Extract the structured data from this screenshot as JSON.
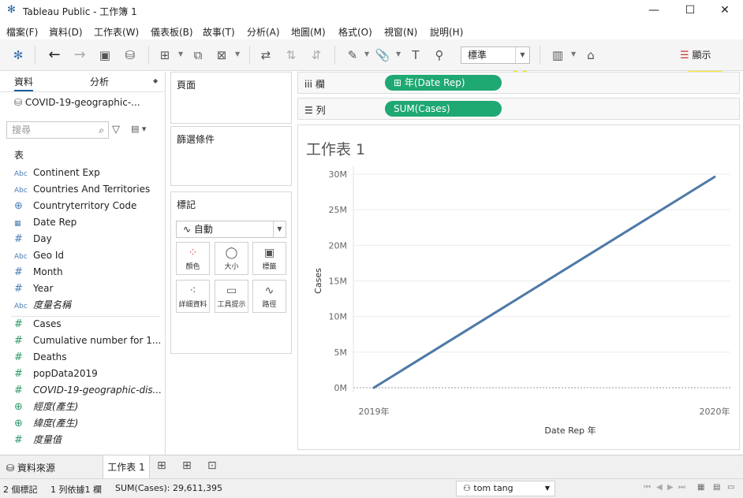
{
  "window": {
    "title": "Tableau Public - 工作簿 1"
  },
  "menu": [
    "檔案(F)",
    "資料(D)",
    "工作表(W)",
    "儀表板(B)",
    "故事(T)",
    "分析(A)",
    "地圖(M)",
    "格式(O)",
    "視窗(N)",
    "說明(H)"
  ],
  "toolbar": {
    "fit_value": "標準",
    "show_me_label": "顯示"
  },
  "data_pane": {
    "tab_data": "資料",
    "tab_analytics": "分析",
    "datasource": "COVID-19-geographic-...",
    "search_placeholder": "搜尋",
    "tables_heading": "表",
    "dimensions": [
      {
        "type": "Abc",
        "name": "Continent Exp",
        "italic": false
      },
      {
        "type": "Abc",
        "name": "Countries And Territories",
        "italic": false
      },
      {
        "type": "globe",
        "name": "Countryterritory Code",
        "italic": false
      },
      {
        "type": "date",
        "name": "Date Rep",
        "italic": false
      },
      {
        "type": "#",
        "name": "Day",
        "italic": false
      },
      {
        "type": "Abc",
        "name": "Geo Id",
        "italic": false
      },
      {
        "type": "#",
        "name": "Month",
        "italic": false
      },
      {
        "type": "#",
        "name": "Year",
        "italic": false
      },
      {
        "type": "Abc",
        "name": "度量名稱",
        "italic": true
      }
    ],
    "measures": [
      {
        "type": "#",
        "name": "Cases",
        "italic": false
      },
      {
        "type": "#",
        "name": "Cumulative number for 1...",
        "italic": false
      },
      {
        "type": "#",
        "name": "Deaths",
        "italic": false
      },
      {
        "type": "#",
        "name": "popData2019",
        "italic": false
      },
      {
        "type": "#",
        "name": "COVID-19-geographic-dis...",
        "italic": true
      },
      {
        "type": "globe",
        "name": "經度(產生)",
        "italic": true
      },
      {
        "type": "globe",
        "name": "緯度(產生)",
        "italic": true
      },
      {
        "type": "#",
        "name": "度量值",
        "italic": true
      }
    ]
  },
  "shelves": {
    "pages": "頁面",
    "filters": "篩選條件",
    "marks": "標記",
    "mark_type": "自動",
    "mark_buttons": [
      "顏色",
      "大小",
      "標籤",
      "詳細資料",
      "工具提示",
      "路徑"
    ],
    "columns_label": "欄",
    "rows_label": "列",
    "columns_pill": "年(Date Rep)",
    "rows_pill": "SUM(Cases)"
  },
  "sheet": {
    "title": "工作表 1"
  },
  "chart_data": {
    "type": "line",
    "x": [
      "2019年",
      "2020年"
    ],
    "series": [
      {
        "values": [
          0,
          29611395
        ]
      }
    ],
    "ylabel": "Cases",
    "xlabel": "Date Rep 年",
    "ylim": [
      0,
      30000000
    ],
    "yticks": [
      "0M",
      "5M",
      "10M",
      "15M",
      "20M",
      "25M",
      "30M"
    ],
    "color": "#4e79a7",
    "grid": true
  },
  "bottom_tabs": {
    "datasource": "資料來源",
    "sheet": "工作表 1"
  },
  "status": {
    "marks": "2 個標記",
    "rows_cols": "1 列依據1 欄",
    "sum": "SUM(Cases): 29,611,395",
    "user": "tom tang"
  }
}
